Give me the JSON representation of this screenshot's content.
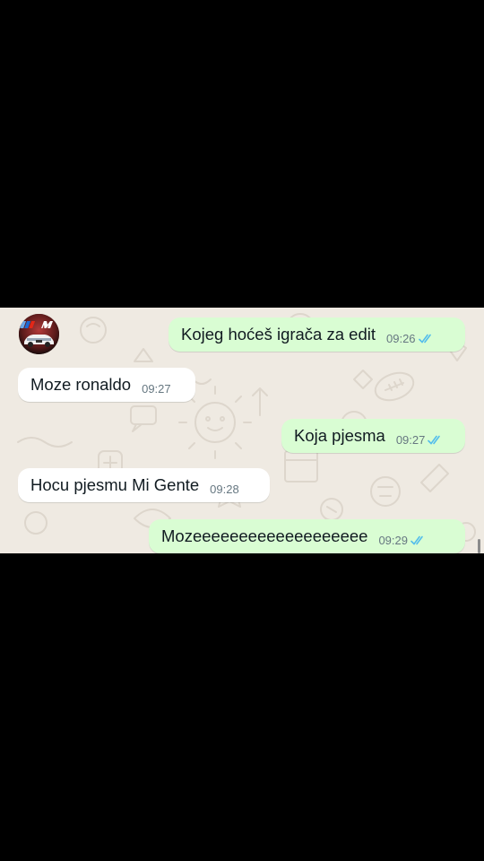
{
  "colors": {
    "outer_background": "#000000",
    "chat_wallpaper": "#efeae2",
    "incoming_bubble": "#ffffff",
    "outgoing_bubble": "#d9fdd3",
    "read_ticks": "#53bdeb",
    "avatar_logo_blue": "#1c69d4",
    "avatar_logo_red": "#e22718"
  },
  "contact": {
    "avatar_icon": "bmw-m-car-avatar-icon",
    "avatar_text": "M"
  },
  "messages": [
    {
      "direction": "outgoing",
      "text": "Kojeg hoćeš igrača za edit",
      "time": "09:26",
      "status": "read"
    },
    {
      "direction": "incoming",
      "text": "Moze ronaldo",
      "time": "09:27"
    },
    {
      "direction": "outgoing",
      "text": "Koja pjesma",
      "time": "09:27",
      "status": "read"
    },
    {
      "direction": "incoming",
      "text": "Hocu pjesmu Mi Gente",
      "time": "09:28"
    },
    {
      "direction": "outgoing",
      "text": "Mozeeeeeeeeeeeeeeeeeee",
      "time": "09:29",
      "status": "read"
    }
  ]
}
